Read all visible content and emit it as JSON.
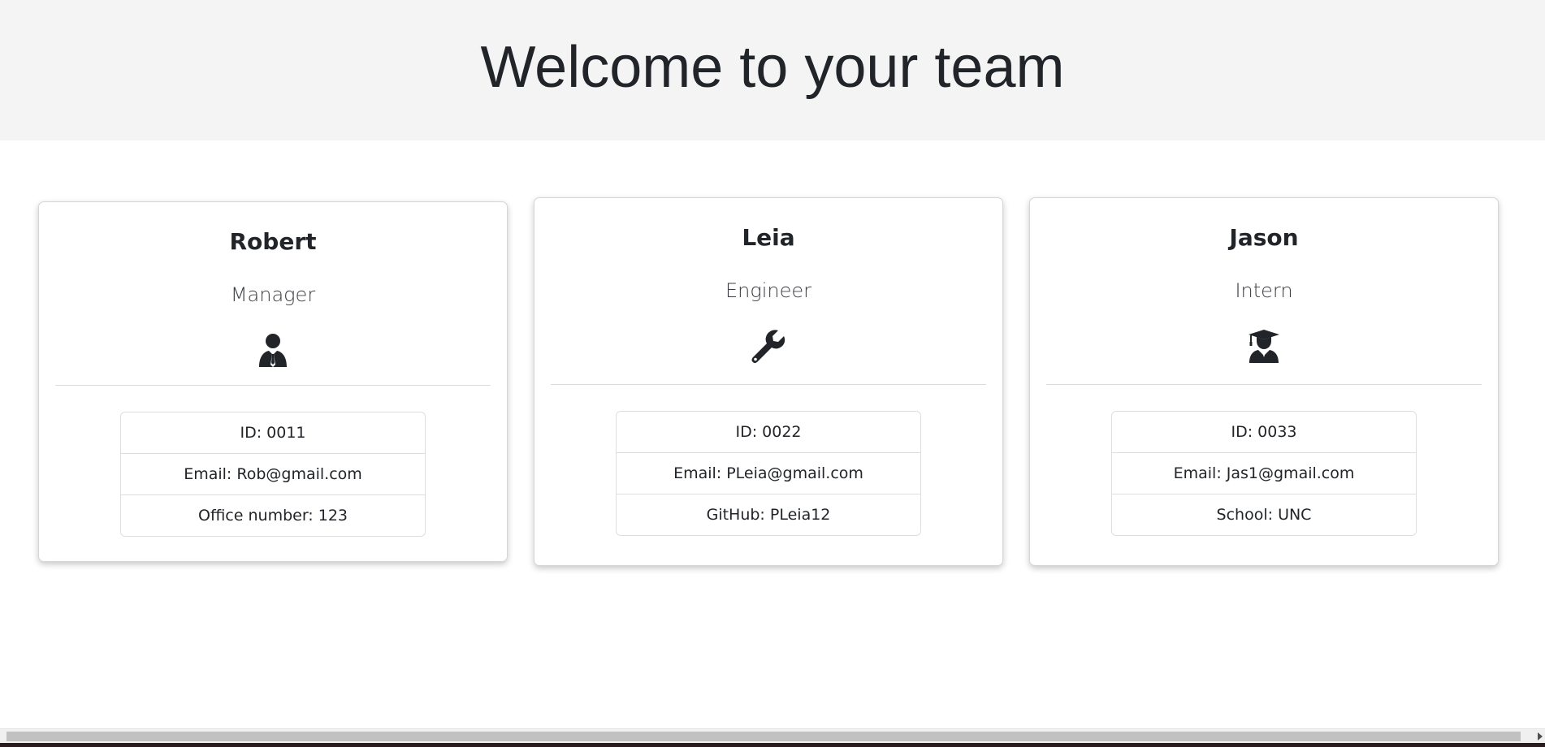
{
  "header": {
    "title": "Welcome to your team"
  },
  "colors": {
    "header_bg": "#f4f4f4",
    "text": "#212529",
    "card_border": "#d6d6d6"
  },
  "team": [
    {
      "name": "Robert",
      "role": "Manager",
      "icon": "user-tie-icon",
      "id_text": "ID: 0011",
      "email_label": "Email: ",
      "email": "Rob@gmail.com",
      "extra_text": "Office number: 123"
    },
    {
      "name": "Leia",
      "role": "Engineer",
      "icon": "wrench-icon",
      "id_text": "ID: 0022",
      "email_label": "Email: ",
      "email": "PLeia@gmail.com",
      "extra_label": "GitHub: ",
      "extra_link": "PLeia12"
    },
    {
      "name": "Jason",
      "role": "Intern",
      "icon": "user-graduate-icon",
      "id_text": "ID: 0033",
      "email_label": "Email: ",
      "email": "Jas1@gmail.com",
      "extra_text": "School: UNC"
    }
  ]
}
